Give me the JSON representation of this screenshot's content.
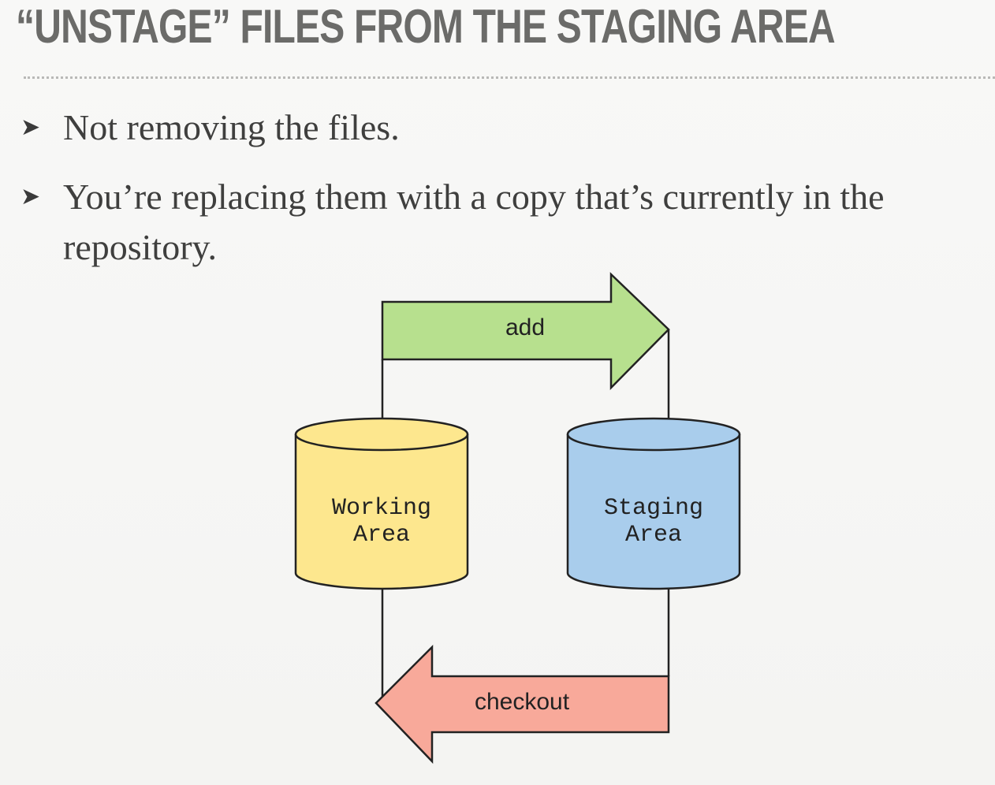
{
  "slide": {
    "title": "“UNSTAGE” FILES FROM THE STAGING AREA",
    "bullets": [
      {
        "text": "Not removing the files."
      },
      {
        "text": "You’re replacing them with a copy that’s currently in the repository."
      }
    ]
  },
  "diagram": {
    "nodes": {
      "working": {
        "line1": "Working",
        "line2": "Area",
        "color": "#fde78e"
      },
      "staging": {
        "line1": "Staging",
        "line2": "Area",
        "color": "#a9cdec"
      }
    },
    "arrows": {
      "add": {
        "label": "add",
        "color": "#b7e08e"
      },
      "checkout": {
        "label": "checkout",
        "color": "#f8a99a"
      }
    }
  },
  "icons": {
    "bullet": "arrowhead-bullet-icon"
  }
}
